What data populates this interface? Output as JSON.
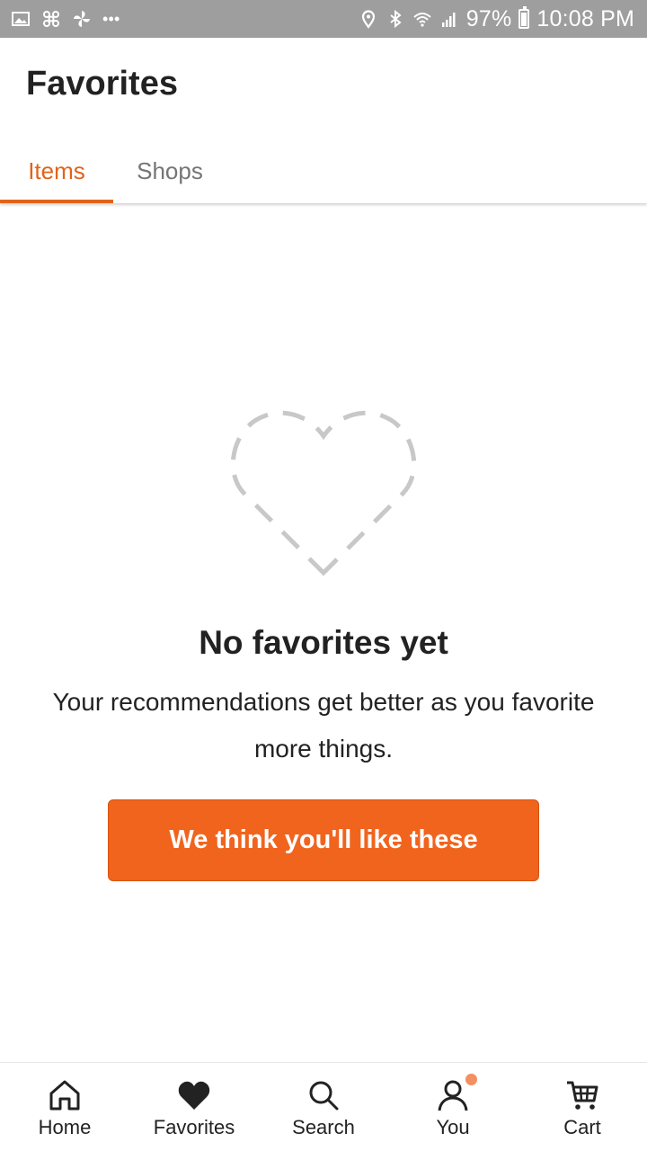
{
  "status_bar": {
    "battery": "97%",
    "time": "10:08 PM",
    "more": "•••",
    "left_icons": [
      "gallery-icon",
      "pinwheel-icon",
      "fan-icon"
    ],
    "right_icons": [
      "location-icon",
      "bluetooth-icon",
      "wifi-icon",
      "signal-icon",
      "battery-icon"
    ]
  },
  "header": {
    "title": "Favorites",
    "tabs": [
      {
        "label": "Items",
        "active": true
      },
      {
        "label": "Shops",
        "active": false
      }
    ],
    "accent_color": "#e0641a"
  },
  "empty_state": {
    "icon": "dashed-heart-icon",
    "title": "No favorites yet",
    "message": "Your recommendations get better as you favorite more things.",
    "button_label": "We think you'll like these",
    "button_color": "#f1641e"
  },
  "bottom_nav": {
    "items": [
      {
        "label": "Home",
        "icon": "home-icon"
      },
      {
        "label": "Favorites",
        "icon": "heart-icon"
      },
      {
        "label": "Search",
        "icon": "search-icon"
      },
      {
        "label": "You",
        "icon": "user-icon",
        "has_notification": true
      },
      {
        "label": "Cart",
        "icon": "cart-icon"
      }
    ]
  }
}
